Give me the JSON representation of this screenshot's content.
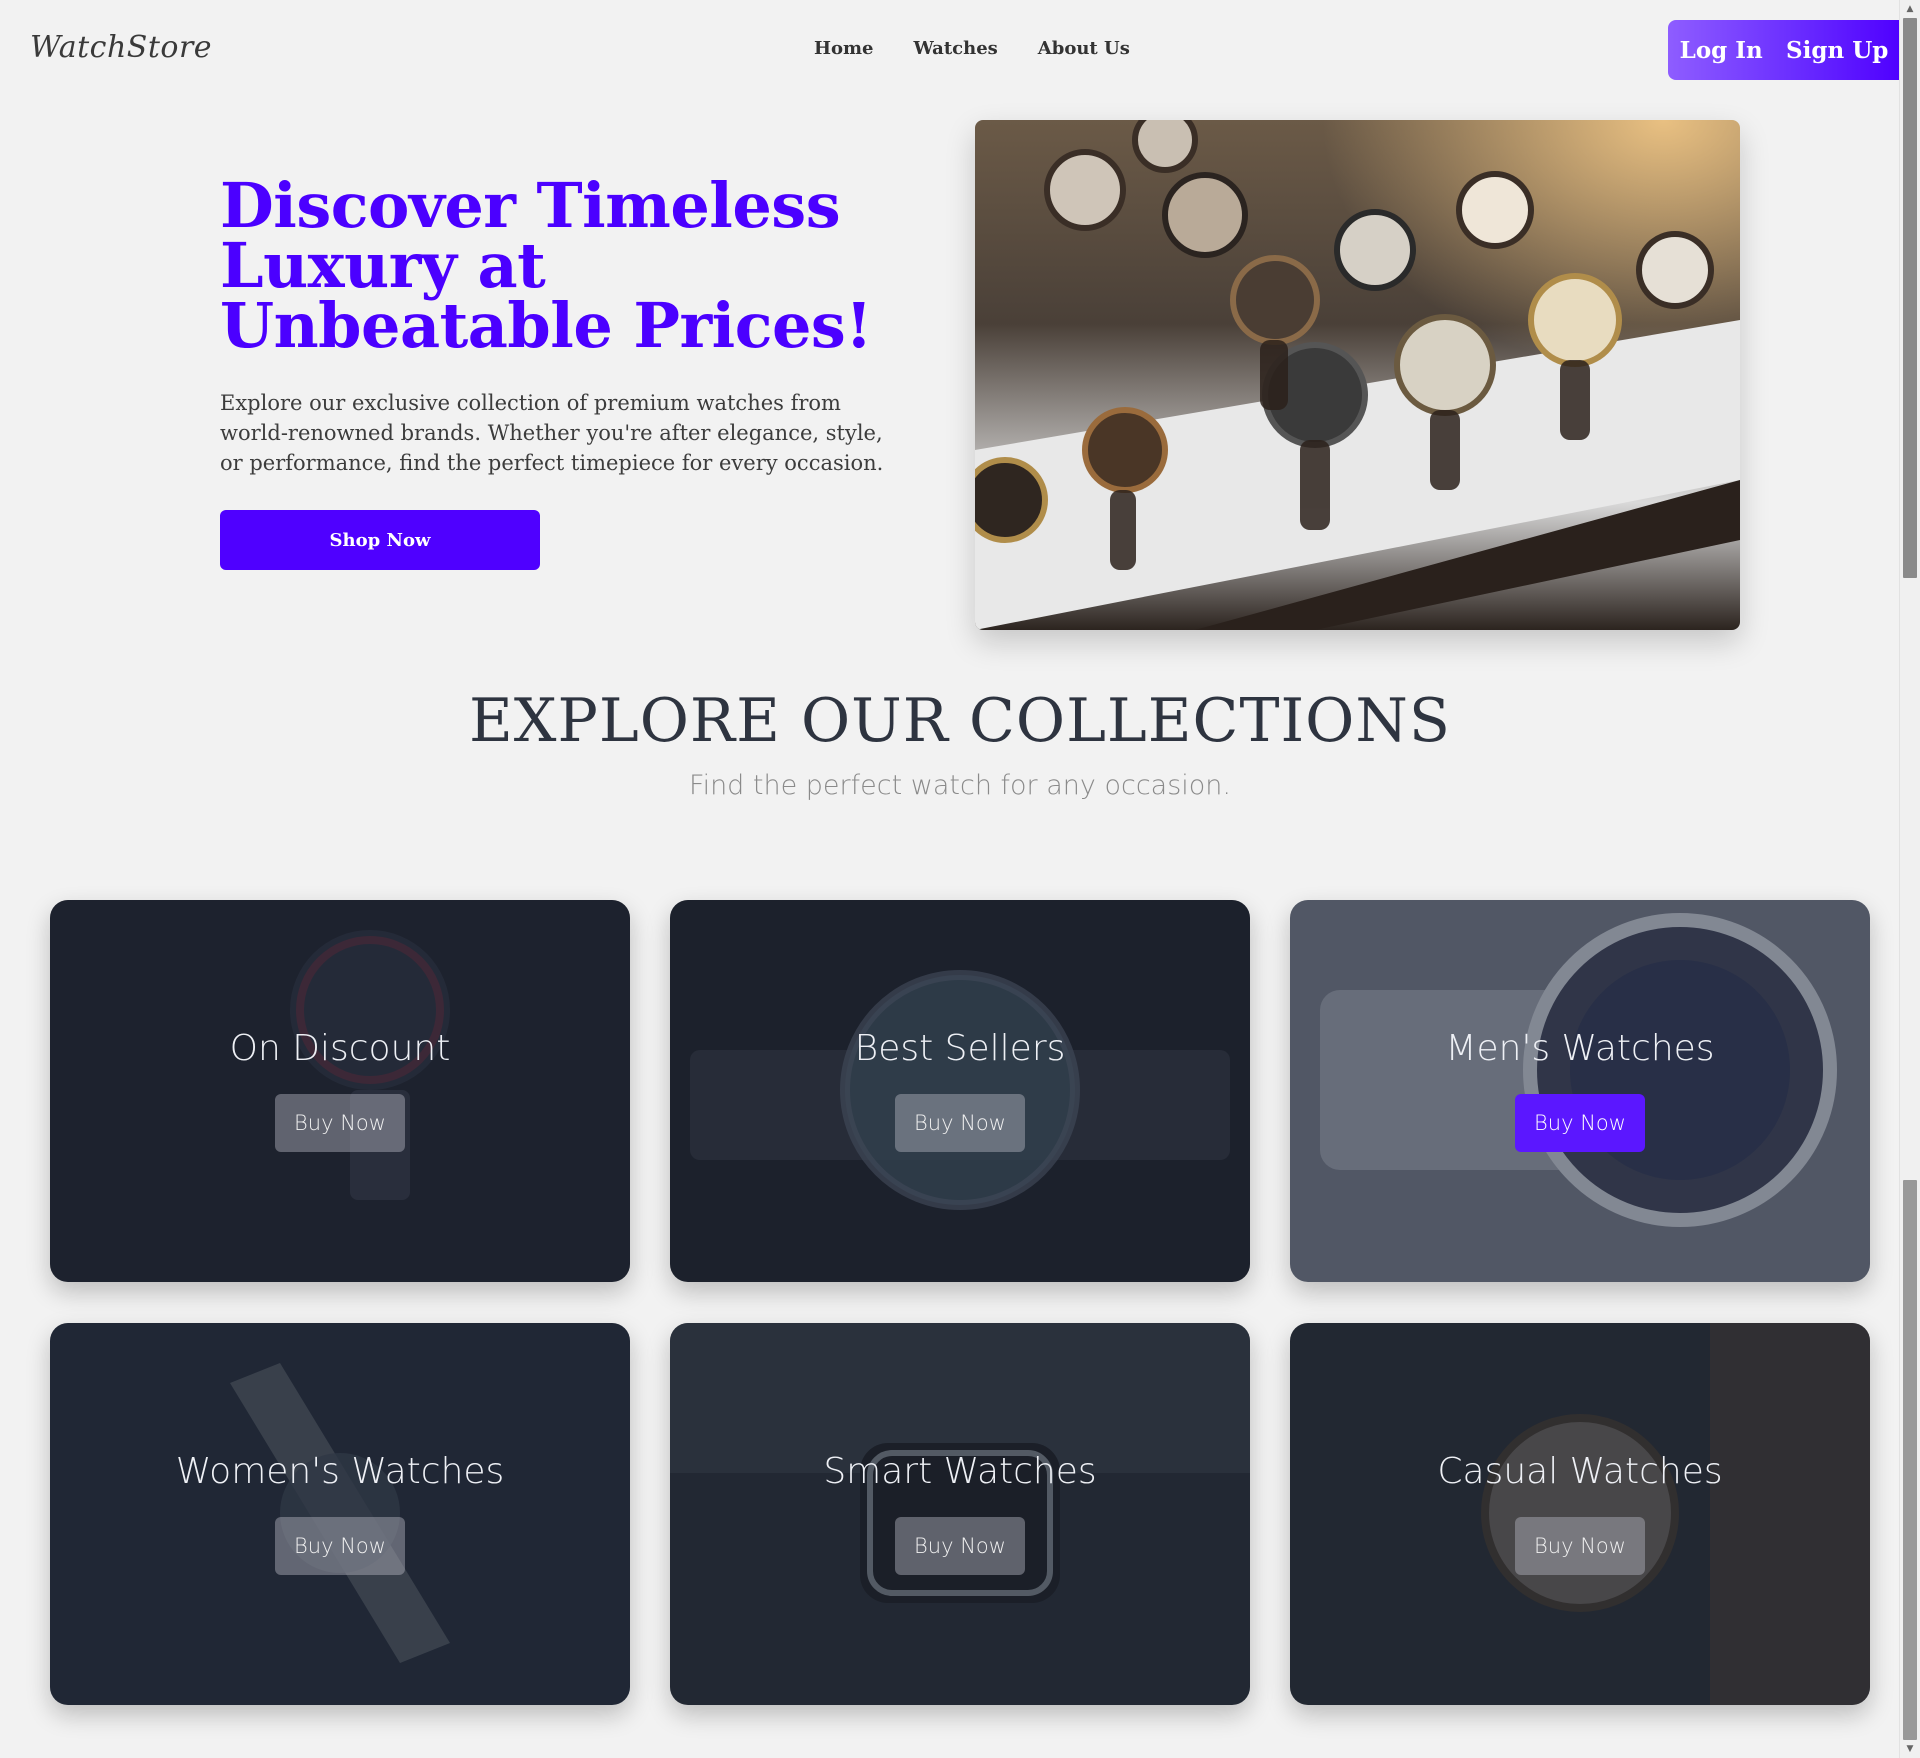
{
  "header": {
    "logo": "WatchStore",
    "nav": [
      "Home",
      "Watches",
      "About Us"
    ],
    "login": "Log In",
    "signup": "Sign Up"
  },
  "hero": {
    "title": "Discover Timeless Luxury at Unbeatable Prices!",
    "description": "Explore our exclusive collection of premium watches from world-renowned brands. Whether you're after elegance, style, or performance, find the perfect timepiece for every occasion.",
    "cta": "Shop Now"
  },
  "collections": {
    "title": "EXPLORE OUR COLLECTIONS",
    "subtitle": "Find the perfect watch for any occasion.",
    "cards": [
      {
        "title": "On Discount",
        "button": "Buy Now"
      },
      {
        "title": "Best Sellers",
        "button": "Buy Now"
      },
      {
        "title": "Men's Watches",
        "button": "Buy Now"
      },
      {
        "title": "Women's Watches",
        "button": "Buy Now"
      },
      {
        "title": "Smart Watches",
        "button": "Buy Now"
      },
      {
        "title": "Casual Watches",
        "button": "Buy Now"
      }
    ]
  },
  "colors": {
    "accent": "#4f00ff",
    "background": "#f2f2f2",
    "card_overlay": "#1e2430"
  }
}
